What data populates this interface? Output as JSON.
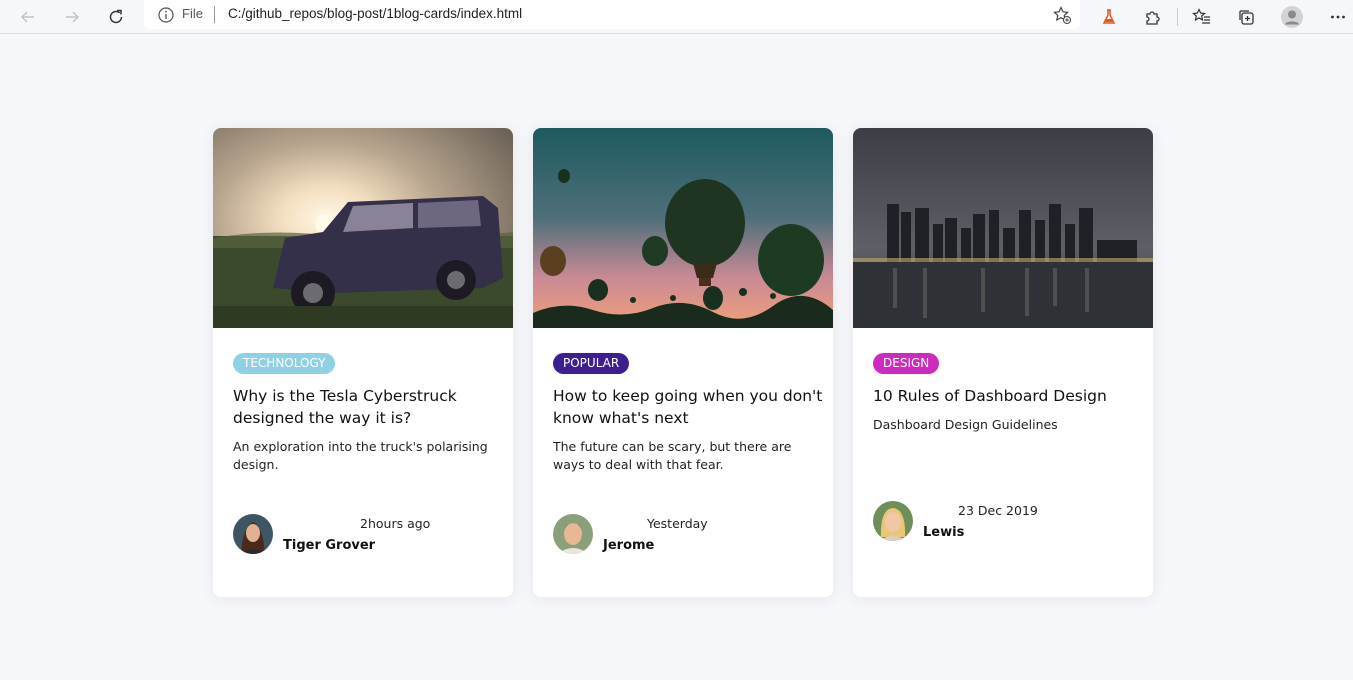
{
  "browser": {
    "scheme": "File",
    "url": "C:/github_repos/blog-post/1blog-cards/index.html"
  },
  "cards": [
    {
      "tag": "TECHNOLOGY",
      "tag_color": "#8fd1e2",
      "title": "Why is the Tesla Cyberstruck designed the way it is?",
      "description": "An exploration into the truck's polarising design.",
      "time": "2hours ago",
      "author": "Tiger Grover"
    },
    {
      "tag": "POPULAR",
      "tag_color": "#3e1f8f",
      "title": "How to keep going when you don't know what's next",
      "description": "The future can be scary, but there are ways to deal with that fear.",
      "time": "Yesterday",
      "author": "Jerome"
    },
    {
      "tag": "DESIGN",
      "tag_color": "#cc2bbd",
      "title": "10 Rules of Dashboard Design",
      "description": "Dashboard Design Guidelines",
      "time": "23 Dec 2019",
      "author": "Lewis"
    }
  ]
}
